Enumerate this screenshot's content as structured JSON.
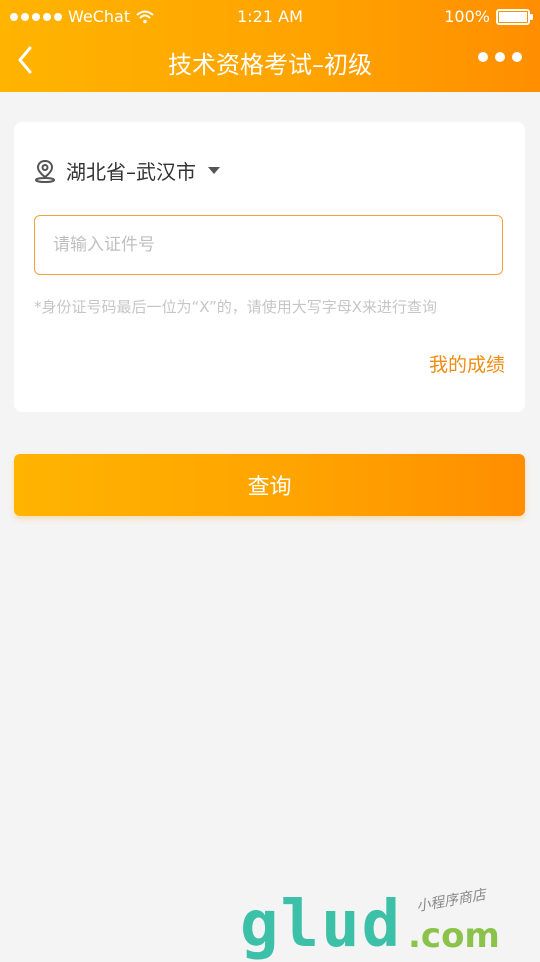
{
  "status_bar": {
    "carrier": "WeChat",
    "time": "1:21 AM",
    "battery": "100%"
  },
  "nav": {
    "title": "技术资格考试–初级"
  },
  "location": {
    "text": "湖北省–武汉市"
  },
  "form": {
    "id_placeholder": "请输入证件号",
    "id_value": "",
    "hint": "*身份证号码最后一位为“X”的，请使用大写字母X来进行查询",
    "my_score_link": "我的成绩"
  },
  "actions": {
    "query_label": "查询"
  },
  "watermark": {
    "logo": "glud",
    "domain": ".com",
    "tagline": "小程序商店"
  },
  "colors": {
    "accent": "#ffa200",
    "link": "#f08c12",
    "input_border": "#f7a13b"
  }
}
